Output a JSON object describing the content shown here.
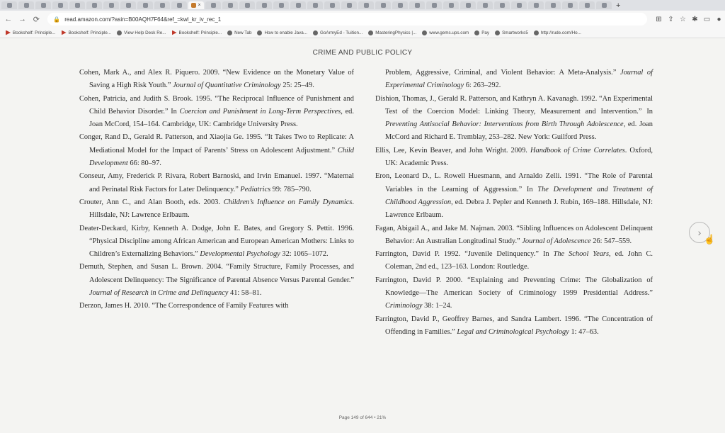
{
  "browser": {
    "url": "read.amazon.com/?asin=B00AQH7F64&ref_=kwl_kr_iv_rec_1",
    "bookmarks": [
      {
        "label": "Bookshelf: Principle...",
        "icon": "arrow-icon"
      },
      {
        "label": "Bookshelf: Principle...",
        "icon": "arrow-icon"
      },
      {
        "label": "View Help Desk Re...",
        "icon": "helpdesk-icon"
      },
      {
        "label": "Bookshelf: Principle...",
        "icon": "arrow-icon"
      },
      {
        "label": "New Tab",
        "icon": "globe-icon"
      },
      {
        "label": "How to enable Java...",
        "icon": "java-icon"
      },
      {
        "label": "GoArmyEd - Tuition...",
        "icon": "globe-icon"
      },
      {
        "label": "MasteringPhysics |...",
        "icon": "physics-icon"
      },
      {
        "label": "www.gems.ups.com",
        "icon": "globe-icon"
      },
      {
        "label": "Pay",
        "icon": "globe-icon"
      },
      {
        "label": "Smartworks5",
        "icon": "globe-icon"
      },
      {
        "label": "http://rude.com/Ho...",
        "icon": "info-icon"
      }
    ],
    "tab_close": "×",
    "new_tab": "+"
  },
  "book": {
    "running_head": "CRIME AND PUBLIC POLICY",
    "footer": "Page 149 of 644 • 21%"
  },
  "left_entries": [
    {
      "a": "Cohen, Mark A., and Alex R. Piquero. 2009. “New Evidence on the Monetary Value of Saving a High Risk Youth.” ",
      "i": "Journal of Quantitative Criminology",
      "b": " 25: 25–49."
    },
    {
      "a": "Cohen, Patricia, and Judith S. Brook. 1995. “The Reciprocal Influence of Punishment and Child Behavior Disorder.” In ",
      "i": "Coercion and Punishment in Long-Term Perspectives",
      "b": ", ed. Joan McCord, 154–164. Cambridge, UK: Cambridge University Press."
    },
    {
      "a": "Conger, Rand D., Gerald R. Patterson, and Xiaojia Ge. 1995. “It Takes Two to Replicate: A Mediational Model for the Impact of Parents’ Stress on Adolescent Adjustment.” ",
      "i": "Child Development",
      "b": " 66: 80–97."
    },
    {
      "a": "Conseur, Amy, Frederick P. Rivara, Robert Barnoski, and Irvin Emanuel. 1997. “Maternal and Perinatal Risk Factors for Later Delinquency.” ",
      "i": "Pediatrics",
      "b": " 99: 785–790."
    },
    {
      "a": "Crouter, Ann C., and Alan Booth, eds. 2003. ",
      "i": "Children’s Influence on Family Dynamics",
      "b": ". Hillsdale, NJ: Lawrence Erlbaum."
    },
    {
      "a": "Deater-Deckard, Kirby, Kenneth A. Dodge, John E. Bates, and Gregory S. Pettit. 1996. “Physical Discipline among African American and European American Mothers: Links to Children’s Externalizing Behaviors.” ",
      "i": "Developmental Psychology",
      "b": " 32: 1065–1072."
    },
    {
      "a": "Demuth, Stephen, and Susan L. Brown. 2004. “Family Structure, Family Processes, and Adolescent Delinquency: The Significance of Parental Absence Versus Parental Gender.” ",
      "i": "Journal of Research in Crime and Delinquency",
      "b": " 41: 58–81."
    },
    {
      "a": "Derzon, James H. 2010. “The Correspondence of Family Features with",
      "i": "",
      "b": ""
    }
  ],
  "right_entries": [
    {
      "a": "Problem, Aggressive, Criminal, and Violent Behavior: A Meta-Analysis.” ",
      "i": "Journal of Experimental Criminology",
      "b": " 6: 263–292.",
      "cont": true
    },
    {
      "a": "Dishion, Thomas, J., Gerald R. Patterson, and Kathryn A. Kavanagh. 1992. “An Experimental Test of the Coercion Model: Linking Theory, Measurement and Intervention.” In ",
      "i": "Preventing Antisocial Behavior: Interventions from Birth Through Adolescence",
      "b": ", ed. Joan McCord and Richard E. Tremblay, 253–282. New York: Guilford Press."
    },
    {
      "a": "Ellis, Lee, Kevin Beaver, and John Wright. 2009. ",
      "i": "Handbook of Crime Correlates",
      "b": ". Oxford, UK: Academic Press."
    },
    {
      "a": "Eron, Leonard D., L. Rowell Huesmann, and Arnaldo Zelli. 1991. “The Role of Parental Variables in the Learning of Aggression.” In ",
      "i": "The Development and Treatment of Childhood Aggression",
      "b": ", ed. Debra J. Pepler and Kenneth J. Rubin, 169–188. Hillsdale, NJ: Lawrence Erlbaum."
    },
    {
      "a": "Fagan, Abigail A., and Jake M. Najman. 2003. “Sibling Influences on Adolescent Delinquent Behavior: An Australian Longitudinal Study.” ",
      "i": "Journal of Adolescence",
      "b": " 26: 547–559."
    },
    {
      "a": "Farrington, David P. 1992. “Juvenile Delinquency.” In ",
      "i": "The School Years",
      "b": ", ed. John C. Coleman, 2nd ed., 123–163. London: Routledge."
    },
    {
      "a": "Farrington, David P. 2000. “Explaining and Preventing Crime: The Globalization of Knowledge—The American Society of Criminology 1999 Presidential Address.” ",
      "i": "Criminology",
      "b": " 38: 1–24."
    },
    {
      "a": "Farrington, David P., Geoffrey Barnes, and Sandra Lambert. 1996. “The Concentration of Offending in Families.” ",
      "i": "Legal and Criminological Psychology",
      "b": " 1: 47–63."
    }
  ],
  "next_page_icon": "chevron-right-icon"
}
